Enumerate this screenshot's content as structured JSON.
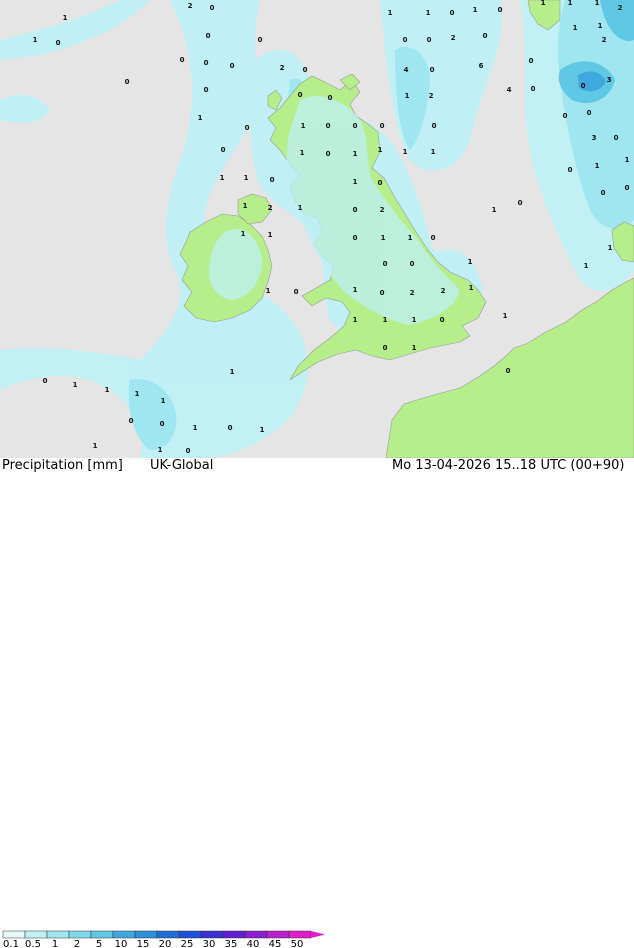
{
  "footer": {
    "title": "Precipitation [mm]",
    "model": "UK-Global",
    "valid_time": "Mo 13-04-2026 15..18 UTC (00+90)"
  },
  "legend": {
    "labels": [
      "0.1",
      "0.5",
      "1",
      "2",
      "5",
      "10",
      "15",
      "20",
      "25",
      "30",
      "35",
      "40",
      "45",
      "50"
    ],
    "colors": [
      "#e6f7fa",
      "#bff0f6",
      "#9fe6f0",
      "#7fd9ea",
      "#5fc8e4",
      "#3fa9df",
      "#2c8fdc",
      "#1f6fd9",
      "#1f4fd6",
      "#3a2fd3",
      "#5f1fd0",
      "#8a1fcf",
      "#b81fcd",
      "#e01fcb"
    ]
  },
  "map": {
    "colors": {
      "sea": "#e5e5e5",
      "land": "#b5ee8a",
      "precip_light": "#bff0f6",
      "precip_mid": "#9fe6f0",
      "precip_heavy": "#5fc8e4",
      "precip_max": "#3fa9df"
    },
    "values": [
      "1",
      "1",
      "0",
      "2",
      "0",
      "0",
      "0",
      "0",
      "0",
      "0",
      "0",
      "2",
      "0",
      "0",
      "0",
      "1",
      "0",
      "0",
      "0",
      "0",
      "1",
      "0",
      "0",
      "1",
      "1",
      "0",
      "1",
      "0",
      "1",
      "1",
      "1",
      "2",
      "1",
      "1",
      "2",
      "2",
      "4",
      "0",
      "3",
      "6",
      "4",
      "0",
      "0",
      "0",
      "0",
      "0",
      "1",
      "2",
      "0",
      "0",
      "0",
      "0",
      "1",
      "1",
      "3",
      "0",
      "1",
      "0",
      "0",
      "1",
      "0",
      "1",
      "1",
      "1",
      "1",
      "0",
      "1",
      "1",
      "0",
      "0",
      "0",
      "1",
      "1",
      "2",
      "1",
      "0",
      "2",
      "1",
      "1",
      "0",
      "1",
      "1",
      "0",
      "1",
      "1",
      "1",
      "0",
      "0",
      "2",
      "1",
      "1",
      "0",
      "2",
      "1",
      "0",
      "1",
      "1",
      "1",
      "0",
      "1",
      "0",
      "1",
      "0",
      "1",
      "0",
      "1",
      "1",
      "1",
      "1",
      "0",
      "0",
      "1",
      "0",
      "1",
      "1",
      "1",
      "0",
      "1",
      "0",
      "1",
      "0",
      "1",
      "0",
      "0"
    ]
  }
}
